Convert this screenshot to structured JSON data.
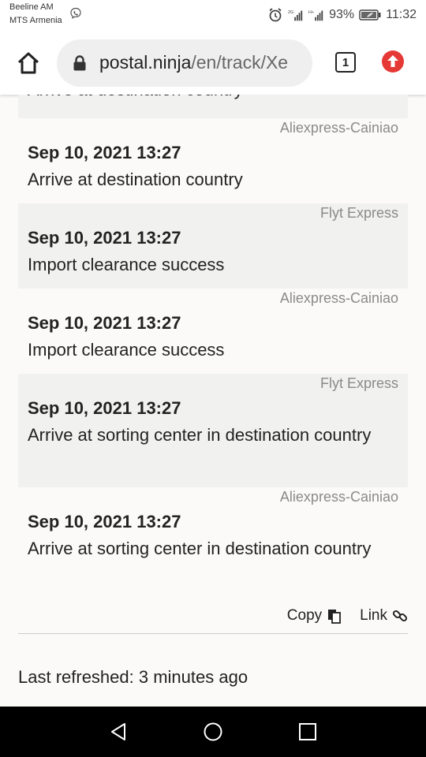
{
  "status": {
    "carrier1": "Beeline AM",
    "carrier2": "MTS Armenia",
    "battery_pct": "93%",
    "time": "11:32",
    "sig1_label": "2G",
    "sig2_label": "H+"
  },
  "browser": {
    "url_host": "postal.ninja",
    "url_path": "/en/track/Xe",
    "tab_count": "1"
  },
  "partial_event": {
    "desc": "Arrive at destination country"
  },
  "events": [
    {
      "carrier": "Aliexpress-Cainiao",
      "date": "Sep 10, 2021 13:27",
      "desc": "Arrive at destination country"
    },
    {
      "carrier": "Flyt Express",
      "date": "Sep 10, 2021 13:27",
      "desc": "Import clearance success"
    },
    {
      "carrier": "Aliexpress-Cainiao",
      "date": "Sep 10, 2021 13:27",
      "desc": "Import clearance success"
    },
    {
      "carrier": "Flyt Express",
      "date": "Sep 10, 2021 13:27",
      "desc": "Arrive at sorting center in destination country"
    },
    {
      "carrier": "Aliexpress-Cainiao",
      "date": "Sep 10, 2021 13:27",
      "desc": "Arrive at sorting center in destination country"
    }
  ],
  "actions": {
    "copy": "Copy",
    "link": "Link"
  },
  "footer": {
    "refreshed": "Last refreshed: 3 minutes ago"
  },
  "colors": {
    "accent_red": "#e53935",
    "shaded_row": "#f1f1f0",
    "carrier_text": "#8a8a8a"
  }
}
